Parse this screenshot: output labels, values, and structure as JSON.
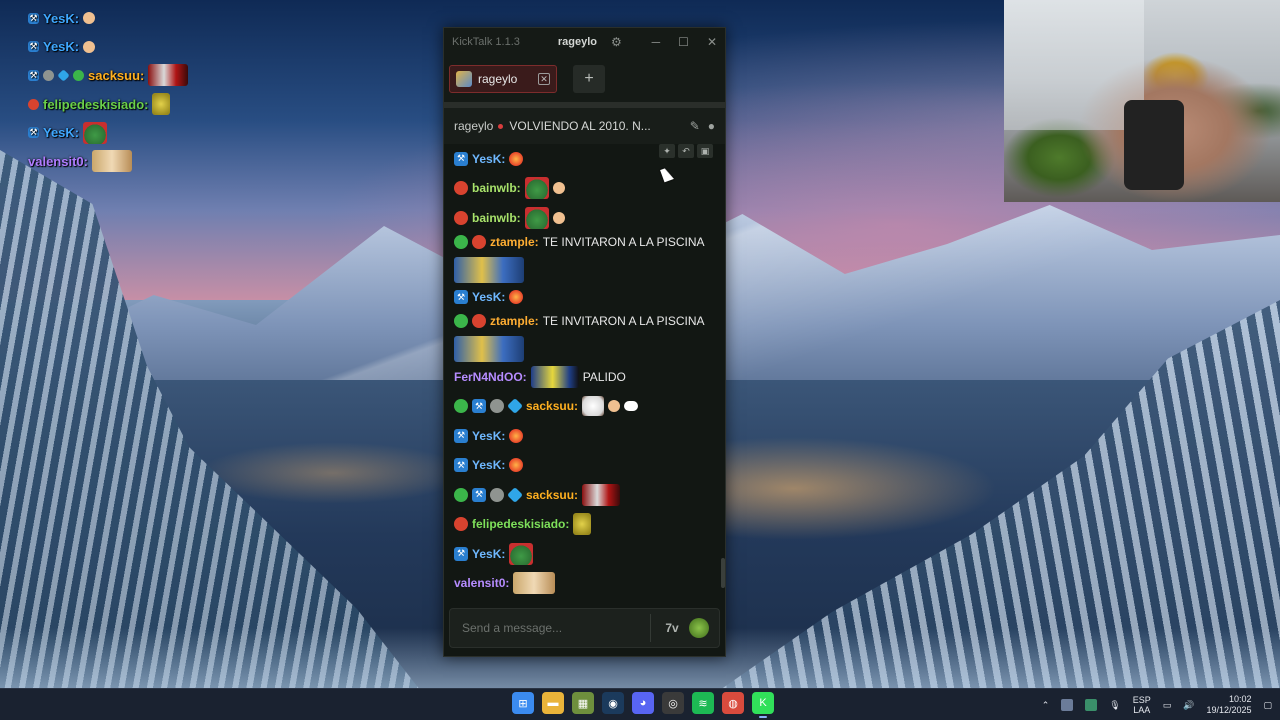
{
  "overlay": {
    "rows": [
      {
        "user": "YesK:",
        "color": "#3fa8ff",
        "badges": [
          "mod"
        ],
        "emote": "small"
      },
      {
        "user": "YesK:",
        "color": "#3fa8ff",
        "badges": [
          "mod"
        ],
        "emote": "small"
      },
      {
        "user": "sacksuu:",
        "color": "#ffb020",
        "badges": [
          "mod",
          "grey",
          "cube",
          "green"
        ],
        "emote": "santa"
      },
      {
        "user": "felipedeskisiado:",
        "color": "#6ad04a",
        "badges": [
          "red"
        ],
        "emote": "banana"
      },
      {
        "user": "YesK:",
        "color": "#3fa8ff",
        "badges": [
          "mod"
        ],
        "emote": "pepe"
      },
      {
        "user": "valensit0:",
        "color": "#b07cff",
        "badges": [],
        "emote": "face"
      }
    ]
  },
  "window": {
    "app_title": "KickTalk 1.1.3",
    "channel": "rageylo",
    "tab_label": "rageylo",
    "add_tab": "+",
    "stream_channel": "rageylo",
    "stream_title": "VOLVIENDO AL 2010. N...",
    "input_placeholder": "Send a message...",
    "translate_label": "7v"
  },
  "messages": [
    {
      "user": "YesK:",
      "color": "#6fb8ff",
      "badges": [
        "mod"
      ],
      "emotes": [
        "fire"
      ],
      "text": ""
    },
    {
      "user": "bainwlb:",
      "color": "#a8e36b",
      "badges": [
        "red"
      ],
      "emotes": [
        "pepe",
        "small"
      ],
      "text": ""
    },
    {
      "user": "bainwlb:",
      "color": "#a8e36b",
      "badges": [
        "red"
      ],
      "emotes": [
        "pepe",
        "small"
      ],
      "text": ""
    },
    {
      "user": "ztample:",
      "color": "#ffae33",
      "badges": [
        "green",
        "red"
      ],
      "emotes": [
        "wide"
      ],
      "text": "TE INVITARON A LA PISCINA",
      "tall": true
    },
    {
      "user": "YesK:",
      "color": "#6fb8ff",
      "badges": [
        "mod"
      ],
      "emotes": [
        "fire"
      ],
      "text": ""
    },
    {
      "user": "ztample:",
      "color": "#ffae33",
      "badges": [
        "green",
        "red"
      ],
      "emotes": [
        "wide"
      ],
      "text": "TE INVITARON A LA PISCINA",
      "tall": true
    },
    {
      "user": "FerN4NdOO:",
      "color": "#b68cff",
      "badges": [],
      "emotes": [
        "car"
      ],
      "text": "PALIDO"
    },
    {
      "user": "sacksuu:",
      "color": "#ffb020",
      "badges": [
        "green",
        "mod",
        "grey",
        "cube"
      ],
      "emotes": [
        "snow",
        "small",
        "eyes"
      ],
      "text": ""
    },
    {
      "user": "YesK:",
      "color": "#6fb8ff",
      "badges": [
        "mod"
      ],
      "emotes": [
        "fire"
      ],
      "text": ""
    },
    {
      "user": "YesK:",
      "color": "#6fb8ff",
      "badges": [
        "mod"
      ],
      "emotes": [
        "fire"
      ],
      "text": ""
    },
    {
      "user": "sacksuu:",
      "color": "#ffb020",
      "badges": [
        "green",
        "mod",
        "grey",
        "cube"
      ],
      "emotes": [
        "santa"
      ],
      "text": ""
    },
    {
      "user": "felipedeskisiado:",
      "color": "#7ee05a",
      "badges": [
        "red"
      ],
      "emotes": [
        "banana"
      ],
      "text": ""
    },
    {
      "user": "YesK:",
      "color": "#6fb8ff",
      "badges": [
        "mod"
      ],
      "emotes": [
        "pepe"
      ],
      "text": ""
    },
    {
      "user": "valensit0:",
      "color": "#b68cff",
      "badges": [],
      "emotes": [
        "face"
      ],
      "text": ""
    }
  ],
  "taskbar": {
    "apps": [
      {
        "name": "start-button",
        "color": "#3b8bf0",
        "glyph": "⊞"
      },
      {
        "name": "file-explorer-app",
        "color": "#e9b33a",
        "glyph": "▬"
      },
      {
        "name": "minecraft-app",
        "color": "#6e8f3d",
        "glyph": "▦"
      },
      {
        "name": "steam-app",
        "color": "#1b3a5c",
        "glyph": "◉"
      },
      {
        "name": "discord-app",
        "color": "#5865f2",
        "glyph": "◕"
      },
      {
        "name": "obs-app",
        "color": "#3a3a3a",
        "glyph": "◎"
      },
      {
        "name": "spotify-app",
        "color": "#1db954",
        "glyph": "≋"
      },
      {
        "name": "chrome-app",
        "color": "#d94b3d",
        "glyph": "◍"
      },
      {
        "name": "kicktalk-app",
        "color": "#31e05a",
        "glyph": "K"
      }
    ],
    "lang_top": "ESP",
    "lang_bottom": "LAA",
    "time": "10:02",
    "date": "19/12/2025"
  }
}
